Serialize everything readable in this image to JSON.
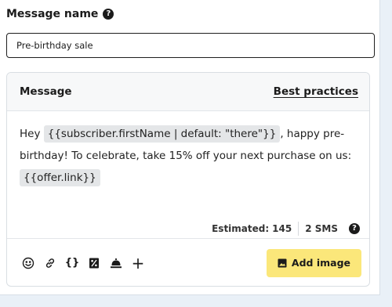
{
  "message_name": {
    "label": "Message name",
    "help_glyph": "?",
    "value": "Pre-birthday sale"
  },
  "message": {
    "title": "Message",
    "best_practices_link": "Best practices",
    "body": {
      "text_1": "Hey ",
      "token_1": "{{subscriber.firstName | default: \"there\"}}",
      "text_2": ", happy pre-birthday! To celebrate, take 15% off your next purchase on us: ",
      "token_2": "{{offer.link}}"
    },
    "estimate": {
      "label": "Estimated:",
      "count": "145",
      "sms": "2 SMS",
      "help_glyph": "?"
    }
  },
  "toolbar": {
    "icons": [
      "emoji-icon",
      "link-icon",
      "braces-icon",
      "discount-icon",
      "bell-icon",
      "plus-icon"
    ],
    "braces_glyph": "{}",
    "plus_glyph": "+",
    "add_image_label": "Add image"
  },
  "colors": {
    "add_image_bg": "#fbe77a",
    "page_bg": "#e9f0f7",
    "token_bg": "#e4e6e8"
  }
}
